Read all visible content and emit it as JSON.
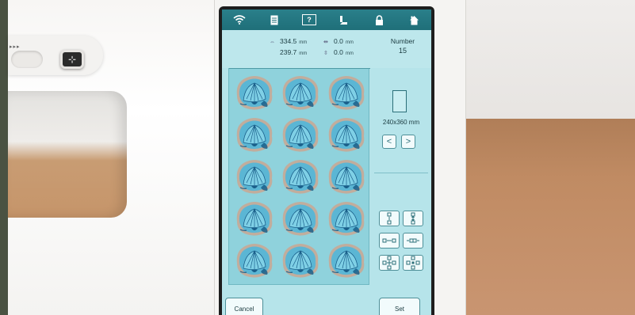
{
  "topbar": {
    "icons": [
      "wifi-icon",
      "document-icon",
      "help-icon",
      "thread-icon",
      "lock-icon",
      "home-icon"
    ],
    "help_label": "?"
  },
  "info": {
    "size_width": "334.5",
    "size_height": "239.7",
    "size_unit": "mm",
    "offset_x": "0.0",
    "offset_y": "0.0",
    "offset_unit": "mm",
    "number_label": "Number",
    "number_value": "15"
  },
  "hoop": {
    "label": "240x360 mm",
    "prev_label": "<",
    "next_label": ">"
  },
  "buttons": {
    "cancel_label": "Cancel",
    "set_label": "Set"
  },
  "preview": {
    "rows": 5,
    "cols": 3,
    "motif_name": "seashell-motif"
  },
  "colors": {
    "screen_bg": "#b6e4ea",
    "topbar": "#1f6f79",
    "motif_fill": "#5bb6d4",
    "motif_outline": "#c7a896",
    "motif_dark": "#1a5f8a"
  }
}
